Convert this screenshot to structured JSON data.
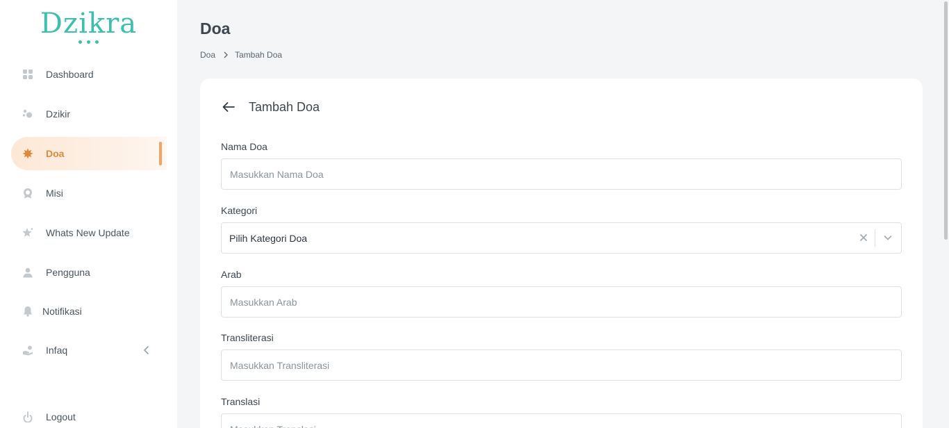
{
  "app": {
    "logo_text": "Dzikra"
  },
  "sidebar": {
    "items": [
      {
        "label": "Dashboard",
        "icon": "dashboard-grid-icon"
      },
      {
        "label": "Dzikir",
        "icon": "prayer-beads-icon"
      },
      {
        "label": "Doa",
        "icon": "star-burst-icon",
        "active": true
      },
      {
        "label": "Misi",
        "icon": "award-badge-icon"
      },
      {
        "label": "Whats New Update",
        "icon": "sparkle-star-icon"
      },
      {
        "label": "Pengguna",
        "icon": "user-icon"
      },
      {
        "label": "Notifikasi",
        "icon": "bell-icon"
      },
      {
        "label": "Infaq",
        "icon": "hand-donation-icon",
        "expandable": true
      }
    ],
    "logout": {
      "label": "Logout",
      "icon": "power-icon"
    }
  },
  "header": {
    "title": "Doa",
    "breadcrumb": [
      "Doa",
      "Tambah Doa"
    ]
  },
  "form": {
    "title": "Tambah Doa",
    "fields": {
      "nama_doa": {
        "label": "Nama Doa",
        "placeholder": "Masukkan Nama Doa",
        "value": ""
      },
      "kategori": {
        "label": "Kategori",
        "selected": "Pilih Kategori Doa"
      },
      "arab": {
        "label": "Arab",
        "placeholder": "Masukkan Arab",
        "value": ""
      },
      "transliterasi": {
        "label": "Transliterasi",
        "placeholder": "Masukkan Transliterasi",
        "value": ""
      },
      "translasi": {
        "label": "Translasi",
        "placeholder": "Masukkan Translasi",
        "value": ""
      }
    }
  },
  "colors": {
    "brand": "#3cbfae",
    "accent": "#e0893d",
    "active_bar": "#f4a466",
    "background": "#f3f5f6"
  }
}
